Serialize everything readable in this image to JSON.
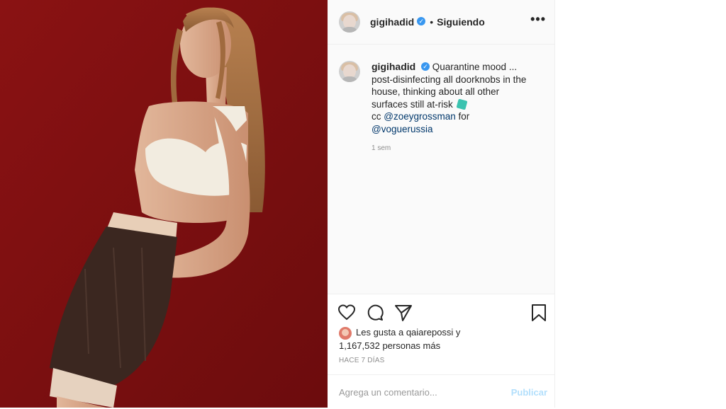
{
  "post": {
    "username": "gigihadid",
    "verified_mark": "✓",
    "separator": "•",
    "follow_status": "Siguiendo",
    "more_options": "•••"
  },
  "caption": {
    "username": "gigihadid",
    "verified_mark": "✓",
    "text_part1": "Quarantine mood ... post-disinfecting all doorknobs in the house, thinking about all other surfaces still at-risk",
    "text_part2": "cc",
    "mention1": "@zoeygrossman",
    "text_part3": "for",
    "mention2": "@voguerussia",
    "age": "1 sem"
  },
  "actions": {
    "like_icon": "heart-icon",
    "comment_icon": "comment-icon",
    "share_icon": "share-icon",
    "save_icon": "bookmark-icon"
  },
  "likes": {
    "line1": "Les gusta a qaiarepossi y",
    "line2": "1,167,532 personas más"
  },
  "timestamp": "HACE 7 DÍAS",
  "comment": {
    "placeholder": "Agrega un comentario...",
    "publish_label": "Publicar"
  },
  "colors": {
    "photo_background": "#7d0f10",
    "accent_blue": "#3897f0",
    "publish_disabled": "#b2dffc"
  }
}
